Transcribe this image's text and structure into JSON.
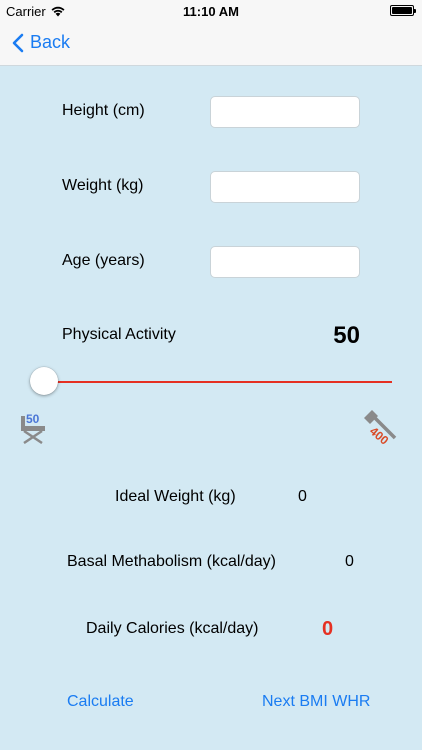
{
  "status_bar": {
    "carrier": "Carrier",
    "time": "11:10 AM"
  },
  "nav": {
    "back_label": "Back"
  },
  "form": {
    "height": {
      "label": "Height (cm)",
      "value": "",
      "placeholder": ""
    },
    "weight": {
      "label": "Weight (kg)",
      "value": "",
      "placeholder": ""
    },
    "age": {
      "label": "Age (years)",
      "value": "",
      "placeholder": ""
    }
  },
  "activity": {
    "label": "Physical Activity",
    "value": "50",
    "slider_level": 0,
    "min_label": "50",
    "max_label": "400",
    "track_color": "#e53022"
  },
  "results": {
    "ideal_weight": {
      "label": "Ideal Weight (kg)",
      "value": "0"
    },
    "basal_metabolism": {
      "label": "Basal Methabolism (kcal/day)",
      "value": "0"
    },
    "daily_calories": {
      "label": "Daily Calories (kcal/day)",
      "value": "0",
      "color": "#e53022"
    }
  },
  "actions": {
    "calculate": "Calculate",
    "next": "Next BMI WHR"
  },
  "colors": {
    "accent": "#1a7cf2",
    "background": "#d3e9f3"
  }
}
